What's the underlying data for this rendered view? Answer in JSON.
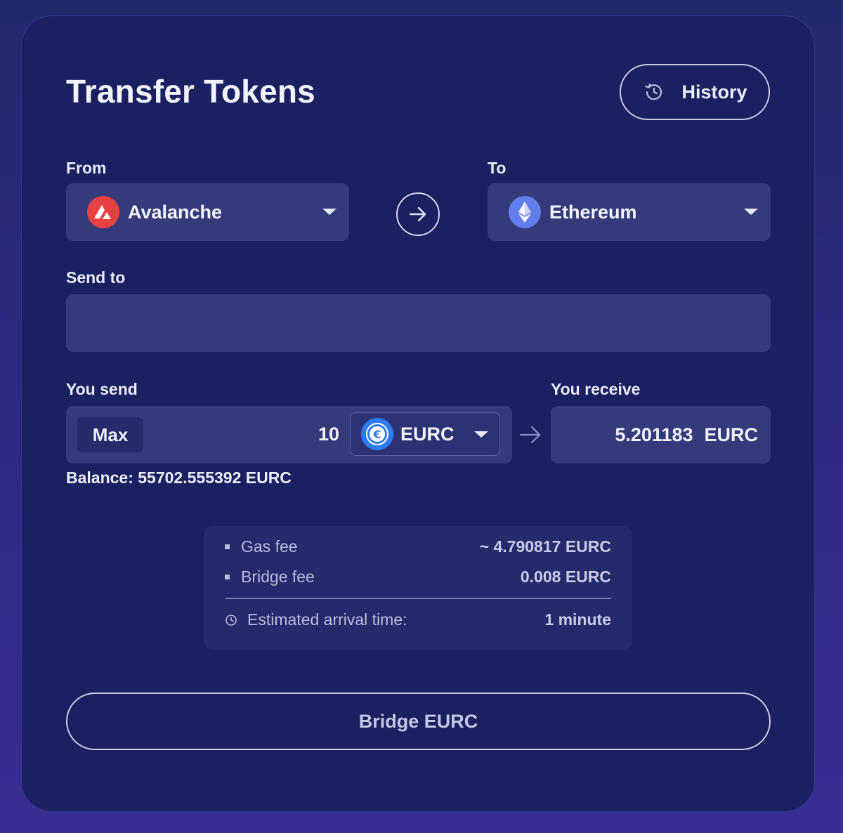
{
  "header": {
    "title": "Transfer Tokens",
    "history_label": "History"
  },
  "from": {
    "label": "From",
    "chain": "Avalanche",
    "icon": "avalanche-logo-icon",
    "icon_color": "#e84142"
  },
  "to": {
    "label": "To",
    "chain": "Ethereum",
    "icon": "ethereum-logo-icon",
    "icon_color": "#627eea"
  },
  "send_to": {
    "label": "Send to",
    "value": "",
    "placeholder": ""
  },
  "send": {
    "label": "You send",
    "max_label": "Max",
    "amount": "10",
    "token": "EURC",
    "token_icon": "eurc-coin-icon",
    "token_color": "#2e7bf6",
    "balance": "Balance: 55702.555392 EURC"
  },
  "receive": {
    "label": "You receive",
    "amount": "5.201183",
    "token": "EURC"
  },
  "fees": {
    "gas_label": "Gas fee",
    "gas_value": "~ 4.790817 EURC",
    "bridge_label": "Bridge fee",
    "bridge_value": "0.008 EURC",
    "arrival_label": "Estimated arrival time:",
    "arrival_value": "1 minute"
  },
  "action": {
    "bridge_label": "Bridge EURC"
  }
}
